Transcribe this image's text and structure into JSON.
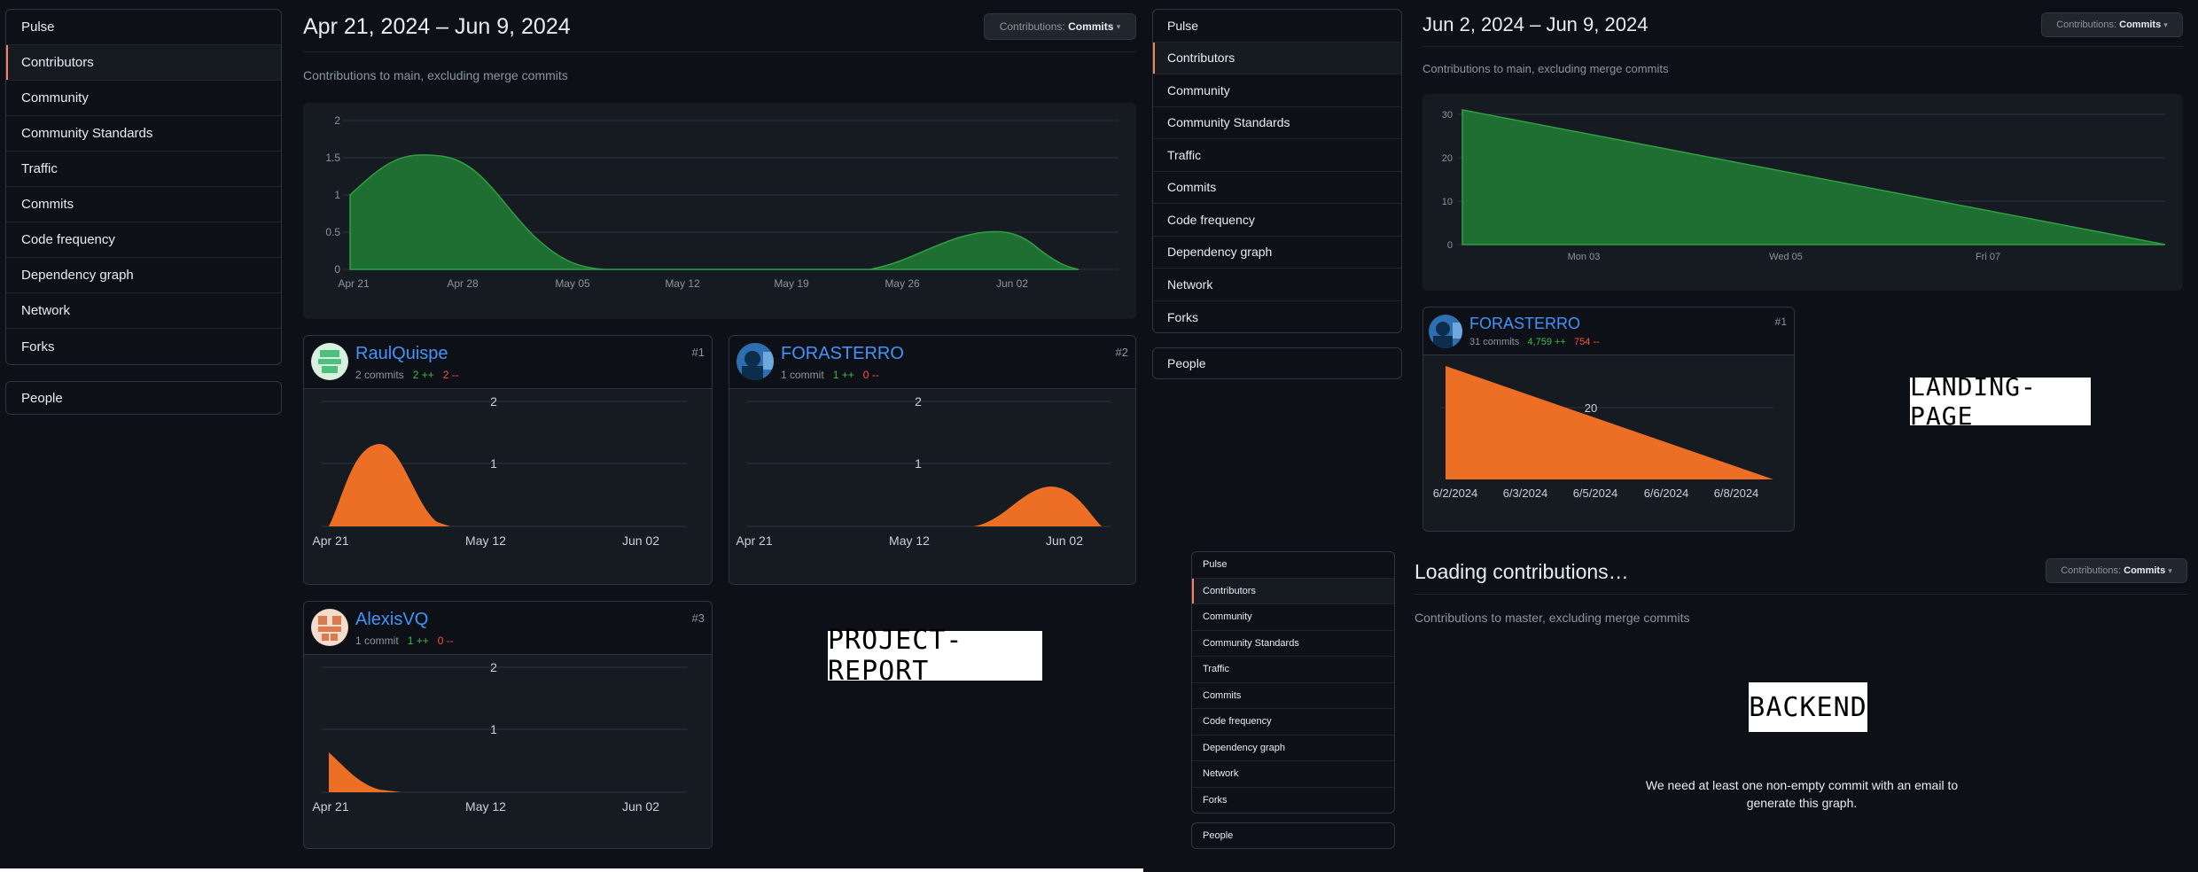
{
  "nav": [
    "Pulse",
    "Contributors",
    "Community",
    "Community Standards",
    "Traffic",
    "Commits",
    "Code frequency",
    "Dependency graph",
    "Network",
    "Forks"
  ],
  "people": "People",
  "btn": {
    "prefix": "Contributions:",
    "value": "Commits",
    "caret": "▾"
  },
  "repo1": {
    "title": "Apr 21, 2024 – Jun 9, 2024",
    "subtitle": "Contributions to main, excluding merge commits",
    "label": "PROJECT-REPORT",
    "overview_yticks": [
      "2",
      "1.5",
      "1",
      "0.5",
      "0"
    ],
    "overview_xticks": [
      "Apr 21",
      "Apr 28",
      "May 05",
      "May 12",
      "May 19",
      "May 26",
      "Jun 02"
    ],
    "card_xticks": [
      "Apr 21",
      "May 12",
      "Jun 02"
    ],
    "card_yticks": [
      "2",
      "1"
    ],
    "contributors": [
      {
        "name": "RaulQuispe",
        "rank": "#1",
        "commits": "2 commits",
        "add": "2 ++",
        "del": "2 --"
      },
      {
        "name": "FORASTERRO",
        "rank": "#2",
        "commits": "1 commit",
        "add": "1 ++",
        "del": "0 --"
      },
      {
        "name": "AlexisVQ",
        "rank": "#3",
        "commits": "1 commit",
        "add": "1 ++",
        "del": "0 --"
      }
    ]
  },
  "repo2": {
    "title": "Jun 2, 2024 – Jun 9, 2024",
    "subtitle": "Contributions to main, excluding merge commits",
    "label": "LANDING-PAGE",
    "overview_yticks": [
      "30",
      "20",
      "10",
      "0"
    ],
    "overview_xticks": [
      "Mon 03",
      "Wed 05",
      "Fri 07"
    ],
    "card_xticks": [
      "6/2/2024",
      "6/3/2024",
      "6/5/2024",
      "6/6/2024",
      "6/8/2024"
    ],
    "card_yticks": [
      "20"
    ],
    "contributors": [
      {
        "name": "FORASTERRO",
        "rank": "#1",
        "commits": "31 commits",
        "add": "4,759 ++",
        "del": "754 --"
      }
    ]
  },
  "repo3": {
    "title": "Loading contributions…",
    "subtitle": "Contributions to master, excluding merge commits",
    "label": "BACKEND",
    "message": "We need at least one non-empty commit with an email to generate this graph."
  },
  "chart_data": [
    {
      "type": "area",
      "series": [
        {
          "values": [
            1,
            1.5,
            1,
            0.2,
            0,
            0,
            0,
            0.2,
            0.65,
            0.3,
            0
          ]
        }
      ],
      "x": [
        "Apr 21",
        "Apr 24",
        "Apr 28",
        "May 05",
        "May 12",
        "May 19",
        "May 26",
        "Jun 02",
        "Jun 05",
        "Jun 09"
      ],
      "ylim": [
        0,
        2
      ]
    },
    {
      "type": "area",
      "series": [
        {
          "values": [
            0,
            1.2,
            0,
            0,
            0
          ]
        }
      ],
      "x": [
        "Apr 21",
        "Apr 28",
        "May 12",
        "Jun 02",
        "Jun 09"
      ],
      "ylim": [
        0,
        2
      ]
    },
    {
      "type": "area",
      "series": [
        {
          "values": [
            0,
            0,
            0,
            0.6,
            0
          ]
        }
      ],
      "x": [
        "Apr 21",
        "May 12",
        "May 26",
        "Jun 02",
        "Jun 09"
      ],
      "ylim": [
        0,
        2
      ]
    },
    {
      "type": "area",
      "series": [
        {
          "values": [
            1,
            0,
            0
          ]
        }
      ],
      "x": [
        "Apr 21",
        "Apr 28",
        "Jun 09"
      ],
      "ylim": [
        0,
        2
      ]
    },
    {
      "type": "area",
      "series": [
        {
          "values": [
            31,
            0
          ]
        }
      ],
      "x": [
        "Jun 02",
        "Jun 09"
      ],
      "ylim": [
        0,
        30
      ]
    },
    {
      "type": "area",
      "series": [
        {
          "values": [
            31,
            0
          ]
        }
      ],
      "x": [
        "6/2/2024",
        "6/8/2024"
      ],
      "ylim": [
        0,
        30
      ]
    }
  ]
}
